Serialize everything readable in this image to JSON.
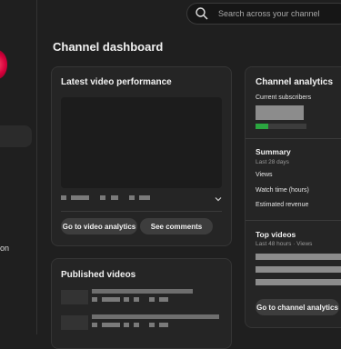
{
  "search": {
    "placeholder": "Search across your channel"
  },
  "sidebar": {
    "partial_label": "on"
  },
  "page": {
    "title": "Channel dashboard"
  },
  "latest_video": {
    "title": "Latest video performance",
    "analytics_button": "Go to video analytics",
    "comments_button": "See comments"
  },
  "published": {
    "title": "Published videos"
  },
  "analytics": {
    "title": "Channel analytics",
    "subscribers_label": "Current subscribers",
    "summary_title": "Summary",
    "summary_period": "Last 28 days",
    "metrics": [
      "Views",
      "Watch time (hours)",
      "Estimated revenue"
    ],
    "top_videos_title": "Top videos",
    "top_videos_period": "Last 48 hours · Views",
    "analytics_button": "Go to channel analytics",
    "accent_color": "#2ba640"
  }
}
